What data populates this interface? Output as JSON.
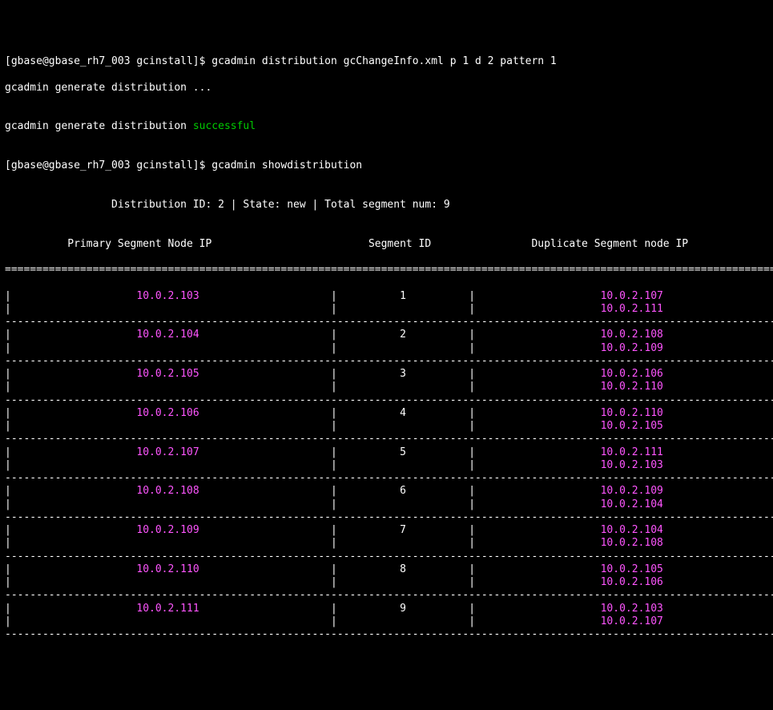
{
  "prompt1": {
    "prefix": "[gbase@gbase_rh7_003 gcinstall]$ ",
    "cmd": "gcadmin distribution gcChangeInfo.xml p 1 d 2 pattern 1"
  },
  "gen_line": "gcadmin generate distribution ...",
  "blank1": "",
  "success_prefix": "gcadmin generate distribution ",
  "success_word": "successful",
  "prompt2": {
    "prefix": "[gbase@gbase_rh7_003 gcinstall]$ ",
    "cmd": "gcadmin showdistribution"
  },
  "summary": "                 Distribution ID: 2 | State: new | Total segment num: 9",
  "hdr": {
    "c1": "Primary Segment Node IP",
    "c2": "Segment ID",
    "c3": "Duplicate Segment node IP"
  },
  "double_rule": "===============================================================================================================================",
  "dash_rule": "-------------------------------------------------------------------------------------------------------------------------------",
  "chart_data": {
    "type": "table",
    "title": "Distribution ID: 2 | State: new | Total segment num: 9",
    "columns": [
      "Primary Segment Node IP",
      "Segment ID",
      "Duplicate Segment node IP"
    ],
    "rows": [
      {
        "primary": "10.0.2.103",
        "segment": "1",
        "dups": [
          "10.0.2.107",
          "10.0.2.111"
        ]
      },
      {
        "primary": "10.0.2.104",
        "segment": "2",
        "dups": [
          "10.0.2.108",
          "10.0.2.109"
        ]
      },
      {
        "primary": "10.0.2.105",
        "segment": "3",
        "dups": [
          "10.0.2.106",
          "10.0.2.110"
        ]
      },
      {
        "primary": "10.0.2.106",
        "segment": "4",
        "dups": [
          "10.0.2.110",
          "10.0.2.105"
        ]
      },
      {
        "primary": "10.0.2.107",
        "segment": "5",
        "dups": [
          "10.0.2.111",
          "10.0.2.103"
        ]
      },
      {
        "primary": "10.0.2.108",
        "segment": "6",
        "dups": [
          "10.0.2.109",
          "10.0.2.104"
        ]
      },
      {
        "primary": "10.0.2.109",
        "segment": "7",
        "dups": [
          "10.0.2.104",
          "10.0.2.108"
        ]
      },
      {
        "primary": "10.0.2.110",
        "segment": "8",
        "dups": [
          "10.0.2.105",
          "10.0.2.106"
        ]
      },
      {
        "primary": "10.0.2.111",
        "segment": "9",
        "dups": [
          "10.0.2.103",
          "10.0.2.107"
        ]
      }
    ]
  }
}
